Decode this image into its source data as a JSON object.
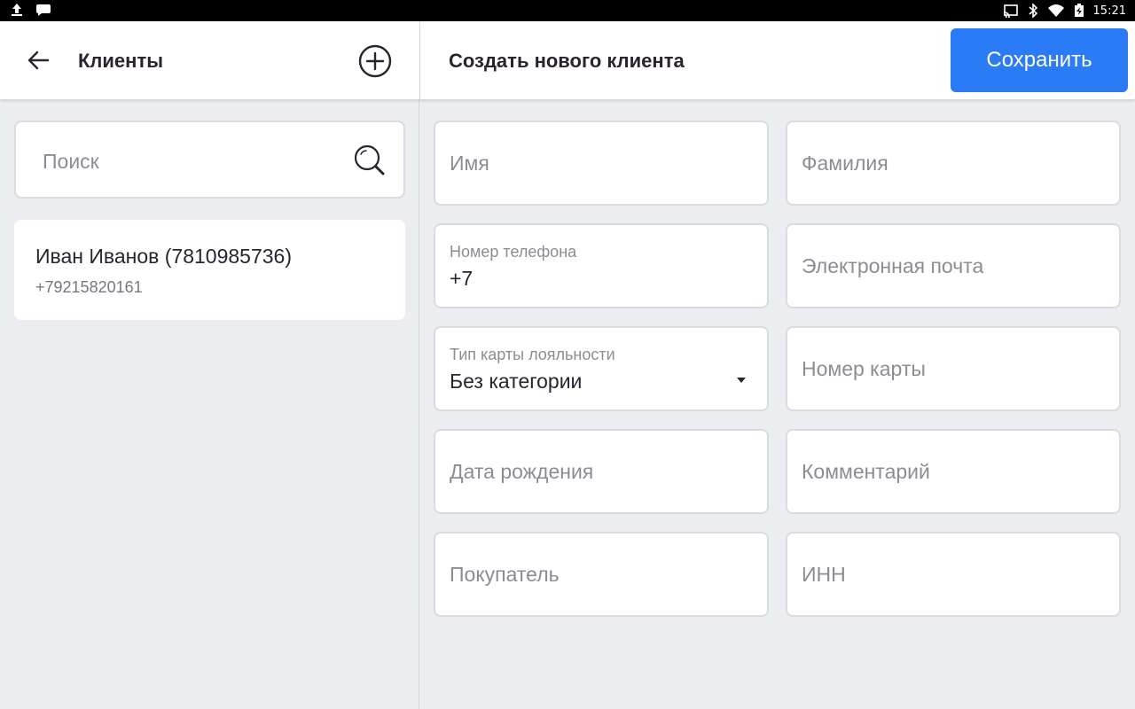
{
  "status_bar": {
    "time": "15:21",
    "left_icons": [
      "upload-icon",
      "message-icon"
    ],
    "right_icons": [
      "cast-icon",
      "bluetooth-icon",
      "wifi-icon",
      "battery-charging-icon"
    ]
  },
  "left_panel": {
    "title": "Клиенты",
    "back_icon": "arrow-left-icon",
    "add_icon": "plus-circle-icon",
    "search": {
      "placeholder": "Поиск",
      "value": ""
    },
    "clients": [
      {
        "name": "Иван Иванов (7810985736)",
        "phone": "+79215820161"
      }
    ]
  },
  "right_panel": {
    "title": "Создать нового клиента",
    "save_label": "Сохранить",
    "fields": {
      "first_name": {
        "placeholder": "Имя"
      },
      "last_name": {
        "placeholder": "Фамилия"
      },
      "phone": {
        "label": "Номер телефона",
        "value": "+7"
      },
      "email": {
        "placeholder": "Электронная почта"
      },
      "loyalty_type": {
        "label": "Тип карты лояльности",
        "value": "Без категории"
      },
      "card_number": {
        "placeholder": "Номер карты"
      },
      "birth_date": {
        "placeholder": "Дата рождения"
      },
      "comment": {
        "placeholder": "Комментарий"
      },
      "buyer": {
        "placeholder": "Покупатель"
      },
      "inn": {
        "placeholder": "ИНН"
      }
    }
  },
  "colors": {
    "accent": "#2b7bf7",
    "background": "#ecedf0",
    "text": "#2b2330",
    "placeholder": "#8f8b95"
  }
}
